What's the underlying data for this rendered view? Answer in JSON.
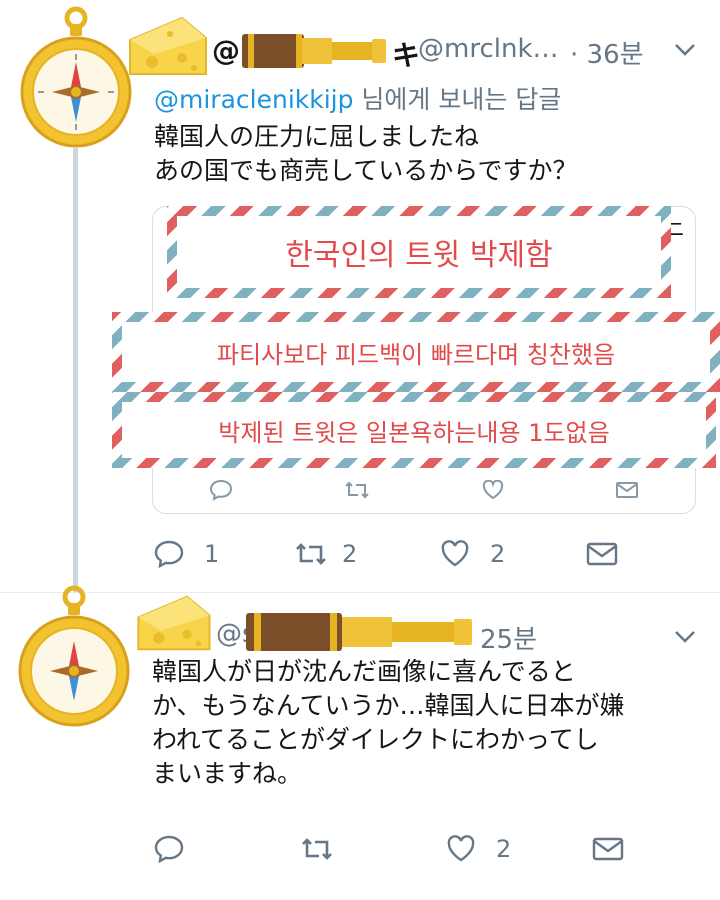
{
  "colors": {
    "link": "#1b95e0",
    "muted": "#657786",
    "stamp_text": "#e24b4b",
    "thread_line": "#ccd6dd"
  },
  "tweet1": {
    "name_prefix": "@",
    "name_suffix": "キ",
    "handle": "@mrclnk…",
    "time": "· 36분",
    "reply_mention": "@miraclenikkijp",
    "reply_suffix": " 님에게 보내는 답글",
    "text_lines": [
      "韓国人の圧力に屈しましたね",
      "あの国でも商売しているからですか？"
    ],
    "quote_partial_char": "ニ",
    "stamps": [
      "한국인의 트윗 박제함",
      "파티사보다 피드백이 빠르다며 칭찬했음",
      "박제된 트윗은 일본욕하는내용 1도없음"
    ],
    "quote_actions": {
      "reply_icon": "reply-icon",
      "retweet_icon": "retweet-icon",
      "like_icon": "heart-icon",
      "dm_icon": "mail-icon"
    },
    "actions": {
      "reply_count": "1",
      "retweet_count": "2",
      "like_count": "2"
    }
  },
  "tweet2": {
    "handle_partial": "@s",
    "time": "25분",
    "text_lines": [
      "韓国人が日が沈んだ画像に喜んでると",
      "か、もうなんていうか…韓国人に日本が嫌",
      "われてることがダイレクトにわかってし",
      "まいますね。"
    ],
    "actions": {
      "reply_count": "",
      "retweet_count": "",
      "like_count": "2"
    }
  }
}
